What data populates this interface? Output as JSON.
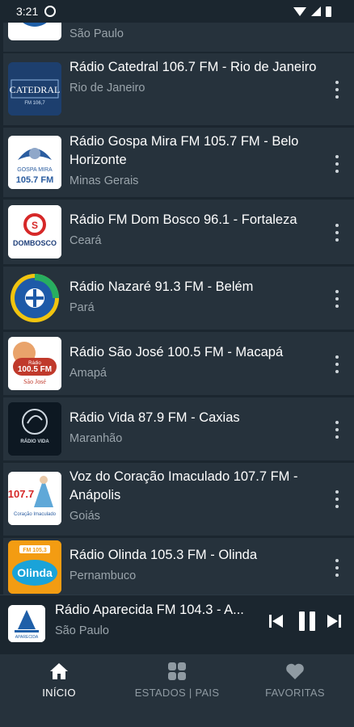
{
  "status": {
    "time": "3:21"
  },
  "stations": [
    {
      "title": "",
      "subtitle": "São Paulo",
      "logo": "aparecida-logo"
    },
    {
      "title": "Rádio Catedral 106.7 FM - Rio de Janeiro",
      "subtitle": "Rio de Janeiro",
      "logo": "catedral-logo"
    },
    {
      "title": "Rádio Gospa Mira FM 105.7 FM - Belo Horizonte",
      "subtitle": "Minas Gerais",
      "logo": "gospa-mira-logo"
    },
    {
      "title": "Rádio FM Dom Bosco 96.1 - Fortaleza",
      "subtitle": "Ceará",
      "logo": "dom-bosco-logo"
    },
    {
      "title": "Rádio Nazaré 91.3 FM - Belém",
      "subtitle": "Pará",
      "logo": "nazare-logo"
    },
    {
      "title": "Rádio São José 100.5 FM - Macapá",
      "subtitle": "Amapá",
      "logo": "sao-jose-logo"
    },
    {
      "title": "Rádio Vida 87.9 FM - Caxias",
      "subtitle": "Maranhão",
      "logo": "vida-logo"
    },
    {
      "title": "Voz do Coração Imaculado 107.7 FM - Anápolis",
      "subtitle": "Goiás",
      "logo": "voz-coracao-logo"
    },
    {
      "title": "Rádio Olinda 105.3 FM - Olinda",
      "subtitle": "Pernambuco",
      "logo": "olinda-logo"
    }
  ],
  "logo_text": {
    "catedral": "CATEDRAL",
    "catedral_sub": "FM 106,7",
    "gospa": "GOSPA MIRA",
    "gospa_freq": "105.7 FM",
    "dom_bosco": "DOMBOSCO",
    "sao_jose": "Rádio",
    "sao_jose_freq": "100.5 FM",
    "sao_jose_place": "São José",
    "vida": "RÁDIO VIDA",
    "voz_freq": "107.7",
    "voz_name": "Coração Imaculado",
    "olinda_freq": "FM 105,3",
    "olinda_name": "Olinda",
    "aparecida": "APARECIDA"
  },
  "player": {
    "title": "Rádio Aparecida FM 104.3 - A...",
    "subtitle": "São Paulo"
  },
  "nav": {
    "home": "INÍCIO",
    "states": "ESTADOS | PAIS",
    "favorites": "FAVORITAS"
  },
  "colors": {
    "background": "#1b262f",
    "card": "#26323c",
    "subtitle": "#9aa4ab"
  }
}
